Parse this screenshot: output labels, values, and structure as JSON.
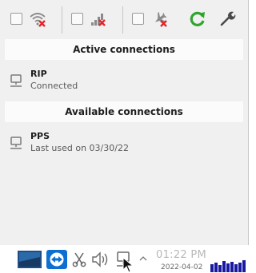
{
  "sections": {
    "active_title": "Active connections",
    "available_title": "Available connections"
  },
  "active_connections": [
    {
      "name": "RIP",
      "status": "Connected",
      "icon": "wired-network-icon"
    }
  ],
  "available_connections": [
    {
      "name": "PPS",
      "status": "Last used on 03/30/22",
      "icon": "wired-network-icon"
    }
  ],
  "toolbar": {
    "wifi": {
      "enabled": false,
      "icon": "wifi-disabled-icon"
    },
    "mobile": {
      "enabled": false,
      "icon": "mobile-broadband-disabled-icon"
    },
    "airplane": {
      "enabled": false,
      "icon": "airplane-mode-disabled-icon"
    },
    "refresh_icon": "refresh-icon",
    "settings_icon": "settings-wrench-icon"
  },
  "taskbar": {
    "time": "01:22 PM",
    "date": "2022-04-02"
  },
  "colors": {
    "disabled_x": "#e0262b",
    "refresh_green": "#2fa52f",
    "popup_bg": "#f0f0f0"
  }
}
